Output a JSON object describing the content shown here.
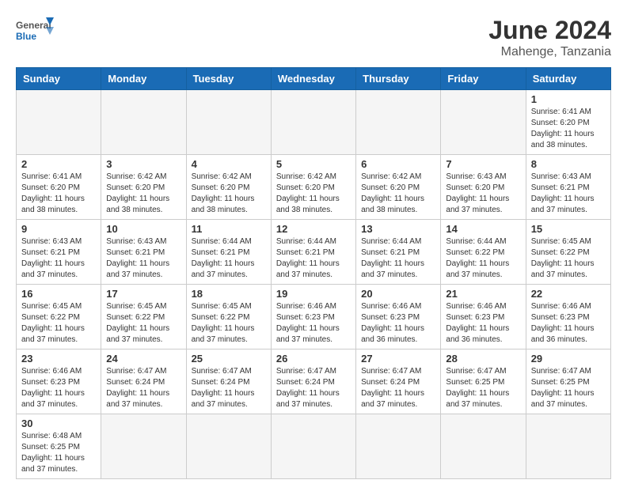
{
  "header": {
    "logo_general": "General",
    "logo_blue": "Blue",
    "title": "June 2024",
    "subtitle": "Mahenge, Tanzania"
  },
  "weekdays": [
    "Sunday",
    "Monday",
    "Tuesday",
    "Wednesday",
    "Thursday",
    "Friday",
    "Saturday"
  ],
  "days": {
    "d1": {
      "num": "1",
      "sunrise": "6:41 AM",
      "sunset": "6:20 PM",
      "daylight": "11 hours and 38 minutes."
    },
    "d2": {
      "num": "2",
      "sunrise": "6:41 AM",
      "sunset": "6:20 PM",
      "daylight": "11 hours and 38 minutes."
    },
    "d3": {
      "num": "3",
      "sunrise": "6:42 AM",
      "sunset": "6:20 PM",
      "daylight": "11 hours and 38 minutes."
    },
    "d4": {
      "num": "4",
      "sunrise": "6:42 AM",
      "sunset": "6:20 PM",
      "daylight": "11 hours and 38 minutes."
    },
    "d5": {
      "num": "5",
      "sunrise": "6:42 AM",
      "sunset": "6:20 PM",
      "daylight": "11 hours and 38 minutes."
    },
    "d6": {
      "num": "6",
      "sunrise": "6:42 AM",
      "sunset": "6:20 PM",
      "daylight": "11 hours and 38 minutes."
    },
    "d7": {
      "num": "7",
      "sunrise": "6:43 AM",
      "sunset": "6:20 PM",
      "daylight": "11 hours and 37 minutes."
    },
    "d8": {
      "num": "8",
      "sunrise": "6:43 AM",
      "sunset": "6:21 PM",
      "daylight": "11 hours and 37 minutes."
    },
    "d9": {
      "num": "9",
      "sunrise": "6:43 AM",
      "sunset": "6:21 PM",
      "daylight": "11 hours and 37 minutes."
    },
    "d10": {
      "num": "10",
      "sunrise": "6:43 AM",
      "sunset": "6:21 PM",
      "daylight": "11 hours and 37 minutes."
    },
    "d11": {
      "num": "11",
      "sunrise": "6:44 AM",
      "sunset": "6:21 PM",
      "daylight": "11 hours and 37 minutes."
    },
    "d12": {
      "num": "12",
      "sunrise": "6:44 AM",
      "sunset": "6:21 PM",
      "daylight": "11 hours and 37 minutes."
    },
    "d13": {
      "num": "13",
      "sunrise": "6:44 AM",
      "sunset": "6:21 PM",
      "daylight": "11 hours and 37 minutes."
    },
    "d14": {
      "num": "14",
      "sunrise": "6:44 AM",
      "sunset": "6:22 PM",
      "daylight": "11 hours and 37 minutes."
    },
    "d15": {
      "num": "15",
      "sunrise": "6:45 AM",
      "sunset": "6:22 PM",
      "daylight": "11 hours and 37 minutes."
    },
    "d16": {
      "num": "16",
      "sunrise": "6:45 AM",
      "sunset": "6:22 PM",
      "daylight": "11 hours and 37 minutes."
    },
    "d17": {
      "num": "17",
      "sunrise": "6:45 AM",
      "sunset": "6:22 PM",
      "daylight": "11 hours and 37 minutes."
    },
    "d18": {
      "num": "18",
      "sunrise": "6:45 AM",
      "sunset": "6:22 PM",
      "daylight": "11 hours and 37 minutes."
    },
    "d19": {
      "num": "19",
      "sunrise": "6:46 AM",
      "sunset": "6:23 PM",
      "daylight": "11 hours and 37 minutes."
    },
    "d20": {
      "num": "20",
      "sunrise": "6:46 AM",
      "sunset": "6:23 PM",
      "daylight": "11 hours and 36 minutes."
    },
    "d21": {
      "num": "21",
      "sunrise": "6:46 AM",
      "sunset": "6:23 PM",
      "daylight": "11 hours and 36 minutes."
    },
    "d22": {
      "num": "22",
      "sunrise": "6:46 AM",
      "sunset": "6:23 PM",
      "daylight": "11 hours and 36 minutes."
    },
    "d23": {
      "num": "23",
      "sunrise": "6:46 AM",
      "sunset": "6:23 PM",
      "daylight": "11 hours and 37 minutes."
    },
    "d24": {
      "num": "24",
      "sunrise": "6:47 AM",
      "sunset": "6:24 PM",
      "daylight": "11 hours and 37 minutes."
    },
    "d25": {
      "num": "25",
      "sunrise": "6:47 AM",
      "sunset": "6:24 PM",
      "daylight": "11 hours and 37 minutes."
    },
    "d26": {
      "num": "26",
      "sunrise": "6:47 AM",
      "sunset": "6:24 PM",
      "daylight": "11 hours and 37 minutes."
    },
    "d27": {
      "num": "27",
      "sunrise": "6:47 AM",
      "sunset": "6:24 PM",
      "daylight": "11 hours and 37 minutes."
    },
    "d28": {
      "num": "28",
      "sunrise": "6:47 AM",
      "sunset": "6:25 PM",
      "daylight": "11 hours and 37 minutes."
    },
    "d29": {
      "num": "29",
      "sunrise": "6:47 AM",
      "sunset": "6:25 PM",
      "daylight": "11 hours and 37 minutes."
    },
    "d30": {
      "num": "30",
      "sunrise": "6:48 AM",
      "sunset": "6:25 PM",
      "daylight": "11 hours and 37 minutes."
    }
  }
}
